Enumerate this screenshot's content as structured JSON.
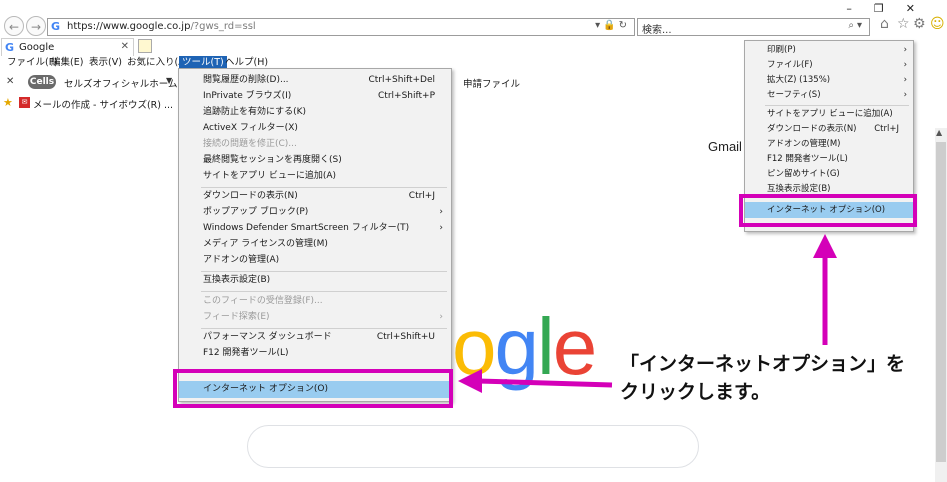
{
  "browser": {
    "url_main": "https://www.google.co.jp",
    "url_rest": "/?gws_rd=ssl",
    "search_placeholder": "検索...",
    "tab_title": "Google"
  },
  "menubar": [
    "ファイル(F)",
    "編集(E)",
    "表示(V)",
    "お気に入り(A)",
    "ツール(T)",
    "ヘルプ(H)"
  ],
  "favbar": {
    "cells_label": "Cells",
    "home_label": "セルズオフィシャルホームページ",
    "shinsei_label": "申請ファイル"
  },
  "bookmarks": {
    "mail_label": "メールの作成 - サイボウズ(R) ..."
  },
  "page": {
    "gmail_label": "Gmail",
    "logo": {
      "o": "o",
      "g": "g",
      "l": "l",
      "e": "e"
    }
  },
  "tools_menu": {
    "items": [
      {
        "label": "閲覧履歴の削除(D)...",
        "shortcut": "Ctrl+Shift+Del"
      },
      {
        "label": "InPrivate ブラウズ(I)",
        "shortcut": "Ctrl+Shift+P"
      },
      {
        "label": "追跡防止を有効にする(K)",
        "shortcut": ""
      },
      {
        "label": "ActiveX フィルター(X)",
        "shortcut": ""
      },
      {
        "label": "接続の問題を修正(C)...",
        "shortcut": ""
      },
      {
        "label": "最終閲覧セッションを再度開く(S)",
        "shortcut": ""
      },
      {
        "label": "サイトをアプリ ビューに追加(A)",
        "shortcut": ""
      },
      {
        "label": "ダウンロードの表示(N)",
        "shortcut": "Ctrl+J"
      },
      {
        "label": "ポップアップ ブロック(P)",
        "shortcut": ""
      },
      {
        "label": "Windows Defender SmartScreen フィルター(T)",
        "shortcut": ""
      },
      {
        "label": "メディア ライセンスの管理(M)",
        "shortcut": ""
      },
      {
        "label": "アドオンの管理(A)",
        "shortcut": ""
      },
      {
        "label": "互換表示設定(B)",
        "shortcut": ""
      },
      {
        "label": "このフィードの受信登録(F)...",
        "shortcut": ""
      },
      {
        "label": "フィード探索(E)",
        "shortcut": ""
      },
      {
        "label": "パフォーマンス ダッシュボード",
        "shortcut": "Ctrl+Shift+U"
      },
      {
        "label": "F12 開発者ツール(L)",
        "shortcut": ""
      },
      {
        "label": "インターネット オプション(O)",
        "shortcut": ""
      }
    ]
  },
  "gear_menu": {
    "items": [
      {
        "label": "印刷(P)",
        "shortcut": ""
      },
      {
        "label": "ファイル(F)",
        "shortcut": ""
      },
      {
        "label": "拡大(Z) (135%)",
        "shortcut": ""
      },
      {
        "label": "セーフティ(S)",
        "shortcut": ""
      },
      {
        "label": "サイトをアプリ ビューに追加(A)",
        "shortcut": ""
      },
      {
        "label": "ダウンロードの表示(N)",
        "shortcut": "Ctrl+J"
      },
      {
        "label": "アドオンの管理(M)",
        "shortcut": ""
      },
      {
        "label": "F12 開発者ツール(L)",
        "shortcut": ""
      },
      {
        "label": "ピン留めサイト(G)",
        "shortcut": ""
      },
      {
        "label": "互換表示設定(B)",
        "shortcut": ""
      },
      {
        "label": "インターネット オプション(O)",
        "shortcut": ""
      }
    ]
  },
  "annotation": {
    "line1": "「インターネットオプション」を",
    "line2": "クリックします。",
    "color": "#d400b8"
  }
}
